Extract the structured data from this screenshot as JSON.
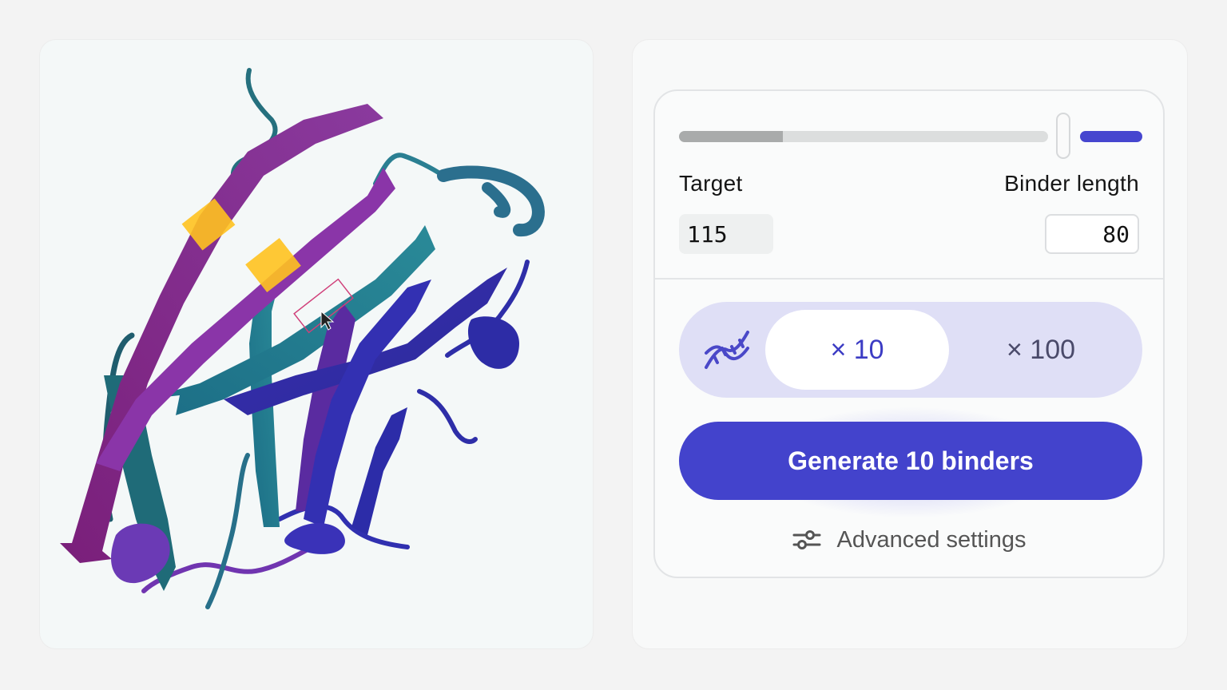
{
  "viewer": {
    "structure": "protein-ribbon",
    "highlight_color": "#ffc21f",
    "strand_colors": [
      "#8e2f98",
      "#2f8e99",
      "#3a35b8"
    ]
  },
  "slider": {
    "target_fraction": 0.22,
    "binder_color": "#4646cf"
  },
  "labels": {
    "target": "Target",
    "binder_length": "Binder length"
  },
  "fields": {
    "target_value": "115",
    "binder_length_value": "80"
  },
  "toggle": {
    "icon": "dna-icon",
    "options": [
      "× 10",
      "× 100"
    ],
    "selected": "× 10"
  },
  "generate_button": {
    "label": "Generate 10 binders",
    "color": "#4343cc"
  },
  "advanced": {
    "icon": "sliders-icon",
    "label": "Advanced settings"
  }
}
